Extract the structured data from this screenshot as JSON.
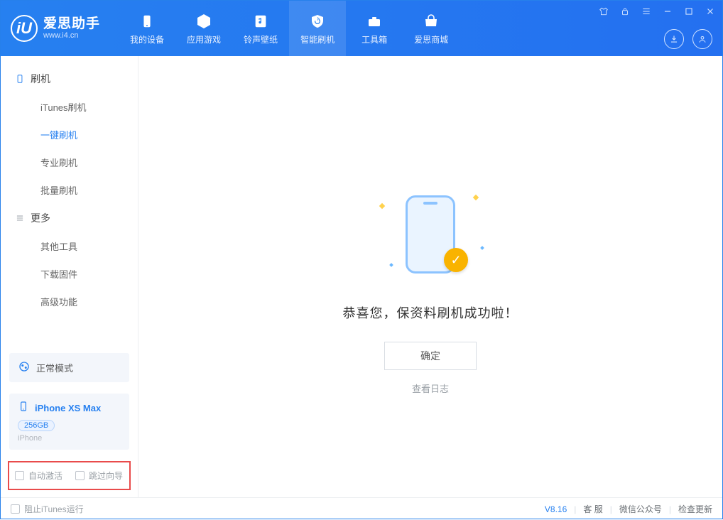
{
  "app": {
    "title": "爱思助手",
    "domain": "www.i4.cn"
  },
  "nav": [
    {
      "label": "我的设备"
    },
    {
      "label": "应用游戏"
    },
    {
      "label": "铃声壁纸"
    },
    {
      "label": "智能刷机"
    },
    {
      "label": "工具箱"
    },
    {
      "label": "爱思商城"
    }
  ],
  "sidebar": {
    "group1": {
      "title": "刷机",
      "items": [
        {
          "label": "iTunes刷机"
        },
        {
          "label": "一键刷机",
          "active": true
        },
        {
          "label": "专业刷机"
        },
        {
          "label": "批量刷机"
        }
      ]
    },
    "group2": {
      "title": "更多",
      "items": [
        {
          "label": "其他工具"
        },
        {
          "label": "下载固件"
        },
        {
          "label": "高级功能"
        }
      ]
    },
    "mode": "正常模式",
    "device": {
      "name": "iPhone XS Max",
      "capacity": "256GB",
      "type": "iPhone"
    },
    "checks": {
      "auto_activate": "自动激活",
      "skip_guide": "跳过向导"
    }
  },
  "main": {
    "title": "恭喜您，保资料刷机成功啦！",
    "ok": "确定",
    "view_log": "查看日志"
  },
  "footer": {
    "block_itunes": "阻止iTunes运行",
    "version": "V8.16",
    "support": "客 服",
    "wechat": "微信公众号",
    "update": "检查更新"
  }
}
